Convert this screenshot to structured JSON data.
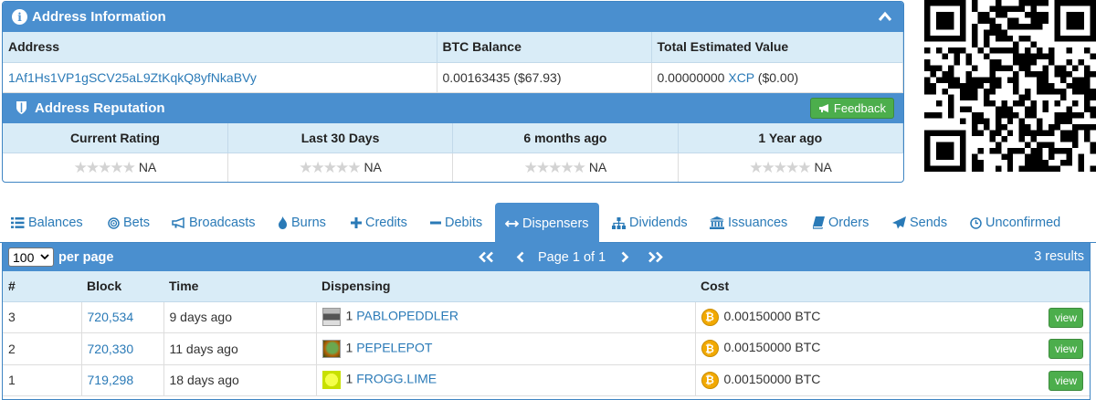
{
  "address_info": {
    "title": "Address Information",
    "columns": [
      "Address",
      "BTC Balance",
      "Total Estimated Value"
    ],
    "address": "1Af1Hs1VP1gSCV25aL9ZtKqkQ8yfNkaBVy",
    "btc_balance": "0.00163435 ($67.93)",
    "total_value_amount": "0.00000000",
    "total_value_asset": "XCP",
    "total_value_usd": "($0.00)"
  },
  "reputation": {
    "title": "Address Reputation",
    "feedback_label": "Feedback",
    "columns": [
      "Current Rating",
      "Last 30 Days",
      "6 months ago",
      "1 Year ago"
    ],
    "stars": "★★★★★",
    "values": [
      "NA",
      "NA",
      "NA",
      "NA"
    ]
  },
  "tabs": [
    {
      "label": "Balances",
      "icon": "list-icon"
    },
    {
      "label": "Bets",
      "icon": "target-icon"
    },
    {
      "label": "Broadcasts",
      "icon": "megaphone-icon"
    },
    {
      "label": "Burns",
      "icon": "fire-icon"
    },
    {
      "label": "Credits",
      "icon": "plus-icon"
    },
    {
      "label": "Debits",
      "icon": "minus-icon"
    },
    {
      "label": "Dispensers",
      "icon": "arrows-horizontal-icon"
    },
    {
      "label": "Dividends",
      "icon": "sitemap-icon"
    },
    {
      "label": "Issuances",
      "icon": "bank-icon"
    },
    {
      "label": "Orders",
      "icon": "book-icon"
    },
    {
      "label": "Sends",
      "icon": "paper-plane-icon"
    },
    {
      "label": "Unconfirmed",
      "icon": "clock-icon"
    }
  ],
  "dispensers": {
    "per_page_value": "100",
    "per_page_label": "per page",
    "page_text": "Page 1 of 1",
    "results_text": "3 results",
    "columns": [
      "#",
      "Block",
      "Time",
      "Dispensing",
      "Cost"
    ],
    "rows": [
      {
        "num": "3",
        "block": "720,534",
        "time": "9 days ago",
        "qty": "1",
        "asset": "PABLOPEDDLER",
        "cost": "0.00150000 BTC",
        "view": "view"
      },
      {
        "num": "2",
        "block": "720,330",
        "time": "11 days ago",
        "qty": "1",
        "asset": "PEPELEPOT",
        "cost": "0.00150000 BTC",
        "view": "view"
      },
      {
        "num": "1",
        "block": "719,298",
        "time": "18 days ago",
        "qty": "1",
        "asset": "FROGG.LIME",
        "cost": "0.00150000 BTC",
        "view": "view"
      }
    ]
  },
  "colors": {
    "panel_blue": "#4a8fcf",
    "header_light": "#d9ecf7",
    "link": "#2a7ab7",
    "button_green": "#4cae4c",
    "btc_orange": "#f2a900"
  }
}
